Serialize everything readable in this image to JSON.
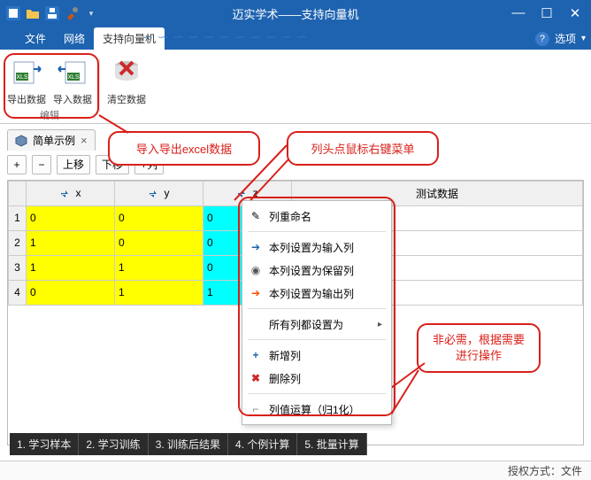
{
  "window": {
    "title": "迈实学术——支持向量机"
  },
  "menubar": {
    "items": [
      "文件",
      "网络",
      "支持向量机"
    ],
    "active_index": 2,
    "right": {
      "help_icon": "?",
      "options_label": "选项",
      "dropdown_glyph": "▾"
    }
  },
  "ribbon": {
    "group_label": "编辑",
    "buttons": [
      {
        "name": "export-data",
        "label": "导出数据"
      },
      {
        "name": "import-data",
        "label": "导入数据"
      },
      {
        "name": "clear-data",
        "label": "清空数据"
      }
    ]
  },
  "callouts": {
    "import_export": "导入导出excel数据",
    "header_context": "列头点鼠标右键菜单",
    "optional": "非必需，根据需要进行操作"
  },
  "file_tab": {
    "label": "简单示例",
    "close": "×"
  },
  "row_toolbar": {
    "add": "+",
    "remove": "−",
    "move_up": "上移",
    "move_down": "下移",
    "add_col": "+列"
  },
  "grid": {
    "columns": [
      {
        "name": "x",
        "io": "in"
      },
      {
        "name": "y",
        "io": "in"
      },
      {
        "name": "z",
        "io": "in"
      }
    ],
    "extra_header": "测试数据",
    "rows": [
      {
        "n": 1,
        "x": "0",
        "y": "0",
        "z": "0"
      },
      {
        "n": 2,
        "x": "1",
        "y": "0",
        "z": "0"
      },
      {
        "n": 3,
        "x": "1",
        "y": "1",
        "z": "0"
      },
      {
        "n": 4,
        "x": "0",
        "y": "1",
        "z": "1"
      }
    ]
  },
  "context_menu": {
    "rename": "列重命名",
    "set_input": "本列设置为输入列",
    "set_keep": "本列设置为保留列",
    "set_output": "本列设置为输出列",
    "set_all": "所有列都设置为",
    "set_all_arrow": "▸",
    "add_col": "新增列",
    "del_col": "删除列",
    "normalize": "列值运算（归1化）"
  },
  "footer_tabs": [
    "1. 学习样本",
    "2. 学习训练",
    "3. 训练后结果",
    "4. 个例计算",
    "5. 批量计算"
  ],
  "status": {
    "text": "授权方式：文件"
  }
}
